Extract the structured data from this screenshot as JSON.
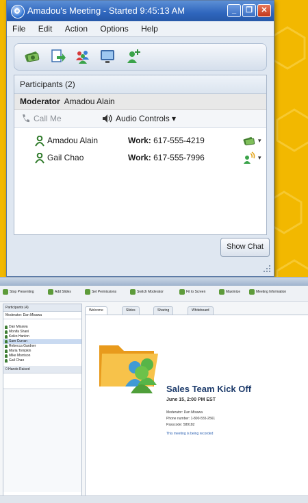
{
  "window": {
    "title": "Amadou's Meeting - Started 9:45:13 AM",
    "controls": {
      "minimize": "_",
      "maximize": "❐",
      "close": "✕"
    }
  },
  "menu": [
    "File",
    "Edit",
    "Action",
    "Options",
    "Help"
  ],
  "toolbar_icons": [
    "money-icon",
    "share-icon",
    "group-icon",
    "screen-icon",
    "add-person-icon"
  ],
  "participants": {
    "header": "Participants (2)",
    "moderator_label": "Moderator",
    "moderator_name": "Amadou Alain",
    "call_me": "Call Me",
    "audio_controls": "Audio Controls ▾",
    "rows": [
      {
        "name": "Amadou Alain",
        "work_label": "Work:",
        "phone": "617-555-4219",
        "status_icon": "money-icon",
        "dd": "▾"
      },
      {
        "name": "Gail Chao",
        "work_label": "Work:",
        "phone": "617-555-7996",
        "status_icon": "speaking-icon",
        "dd": "▾"
      }
    ]
  },
  "show_chat": "Show Chat",
  "background_app": {
    "toolbar": [
      "Stop Presenting",
      "Add Slides",
      "Set Permissions",
      "Switch Moderator",
      "Fit to Screen",
      "Maximize",
      "Meeting Information"
    ],
    "sidebar_header": "Participants (4)",
    "sidebar_moderator": "Moderator: Dan Misawa",
    "sidebar_people": [
      "Dan Misawa",
      "Monifa Shani",
      "Keiko Hanlon",
      "Sam Curran",
      "Rebecca Gardner",
      "Maria Tompkin",
      "Mike Morrison",
      "Gail Chao"
    ],
    "hands_raised": "0 Hands Raised",
    "tabs": [
      "Welcome",
      "Slides",
      "Sharing",
      "Whiteboard"
    ],
    "welcome_title": "Sales Team Kick Off",
    "welcome_date": "June 15, 2:00 PM EST",
    "moderator_line": "Moderator: Dan Misawa",
    "phone_line": "Phone number: 1-800-555-2561",
    "passcode_line": "Passcode: 589182",
    "recording_note": "This meeting is being recorded"
  }
}
